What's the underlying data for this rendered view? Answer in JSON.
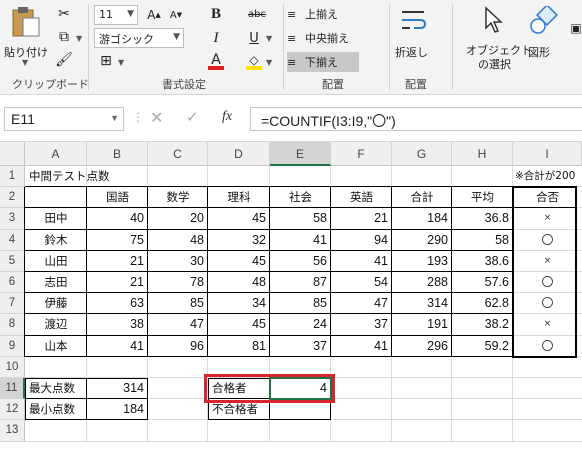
{
  "ribbon": {
    "clipboard": {
      "paste": "貼り付け",
      "group": "クリップボード"
    },
    "font": {
      "size": "11",
      "name": "游ゴシック",
      "bold": "B",
      "italic": "I",
      "strike": "abc",
      "underline": "U",
      "font_color_letter": "A",
      "group": "書式設定"
    },
    "alignment": {
      "top": "上揃え",
      "middle": "中央揃え",
      "bottom": "下揃え",
      "group": "配置"
    },
    "wrap": {
      "label": "折返し",
      "group": "配置"
    },
    "select_objects": {
      "line1": "オブジェクト",
      "line2": "の選択"
    },
    "shapes": {
      "label": "図形"
    }
  },
  "formula_bar": {
    "name_box": "E11",
    "formula": "=COUNTIF(I3:I9,\"〇\")",
    "fx": "fx"
  },
  "columns": [
    "A",
    "B",
    "C",
    "D",
    "E",
    "F",
    "G",
    "H",
    "I"
  ],
  "rows": [
    "1",
    "2",
    "3",
    "4",
    "5",
    "6",
    "7",
    "8",
    "9",
    "10",
    "11",
    "12",
    "13"
  ],
  "sheet": {
    "title": "中間テスト点数",
    "note": "※合計が200",
    "headers": [
      "国語",
      "数学",
      "理科",
      "社会",
      "英語",
      "合計",
      "平均",
      "合否"
    ],
    "records": [
      {
        "name": "田中",
        "scores": [
          "40",
          "20",
          "45",
          "58",
          "21",
          "184",
          "36.8"
        ],
        "result": "×"
      },
      {
        "name": "鈴木",
        "scores": [
          "75",
          "48",
          "32",
          "41",
          "94",
          "290",
          "58"
        ],
        "result": "〇"
      },
      {
        "name": "山田",
        "scores": [
          "21",
          "30",
          "45",
          "56",
          "41",
          "193",
          "38.6"
        ],
        "result": "×"
      },
      {
        "name": "志田",
        "scores": [
          "21",
          "78",
          "48",
          "87",
          "54",
          "288",
          "57.6"
        ],
        "result": "〇"
      },
      {
        "name": "伊藤",
        "scores": [
          "63",
          "85",
          "34",
          "85",
          "47",
          "314",
          "62.8"
        ],
        "result": "〇"
      },
      {
        "name": "渡辺",
        "scores": [
          "38",
          "47",
          "45",
          "24",
          "37",
          "191",
          "38.2"
        ],
        "result": "×"
      },
      {
        "name": "山本",
        "scores": [
          "41",
          "96",
          "81",
          "37",
          "41",
          "296",
          "59.2"
        ],
        "result": "〇"
      }
    ],
    "max_label": "最大点数",
    "max_value": "314",
    "min_label": "最小点数",
    "min_value": "184",
    "pass_label": "合格者",
    "pass_value": "4",
    "fail_label": "不合格者"
  },
  "colors": {
    "highlight": "#d9262e",
    "ribbon_bg": "#f3f3f3",
    "header_bg": "#efefef",
    "active_col": "#d3d3d3",
    "font_color": "#e02020",
    "fill_color": "#ffe600"
  }
}
